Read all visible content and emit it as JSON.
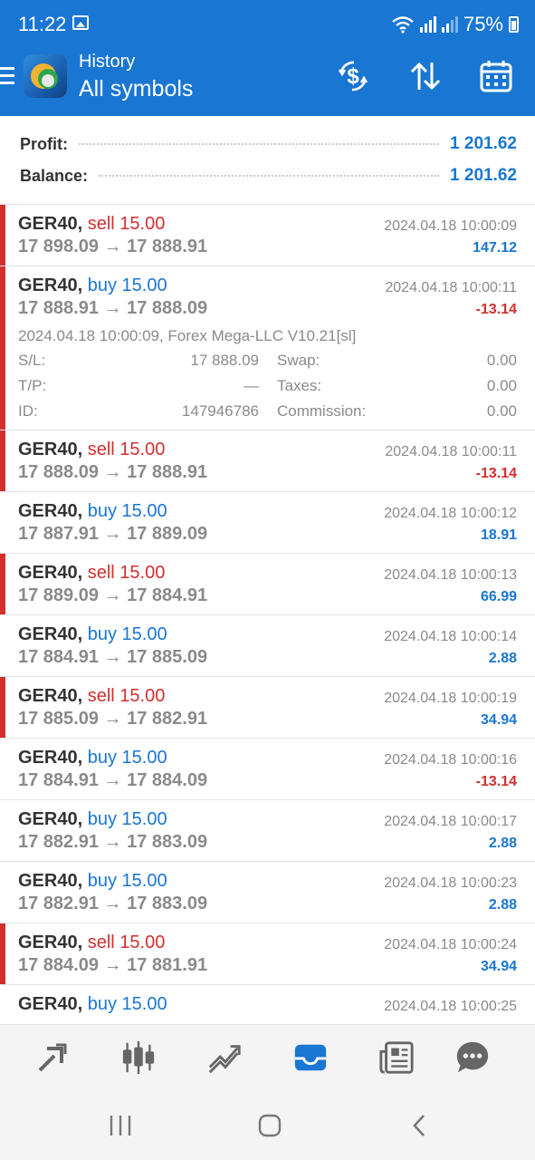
{
  "status_bar": {
    "time": "11:22",
    "battery": "75%"
  },
  "header": {
    "subtitle": "History",
    "title": "All symbols",
    "icons": [
      "menu-icon",
      "app-logo",
      "exchange-dollar-icon",
      "sort-icon",
      "calendar-icon"
    ]
  },
  "summary": {
    "profit_label": "Profit:",
    "profit_value": "1 201.62",
    "balance_label": "Balance:",
    "balance_value": "1 201.62"
  },
  "deals": [
    {
      "symbol": "GER40,",
      "side": "sell",
      "volume": "sell 15.00",
      "prices": "17 898.09 → 17 888.91",
      "time": "2024.04.18 10:00:09",
      "profit": "147.12",
      "profit_sign": "pos"
    },
    {
      "symbol": "GER40,",
      "side": "buy",
      "volume": "buy 15.00",
      "prices": "17 888.91 → 17 888.09",
      "time": "2024.04.18 10:00:11",
      "profit": "-13.14",
      "profit_sign": "neg",
      "details": {
        "comment": "2024.04.18 10:00:09, Forex Mega-LLC V10.21[sl]",
        "sl_label": "S/L:",
        "sl_value": "17 888.09",
        "swap_label": "Swap:",
        "swap_value": "0.00",
        "tp_label": "T/P:",
        "tp_value": "—",
        "taxes_label": "Taxes:",
        "taxes_value": "0.00",
        "id_label": "ID:",
        "id_value": "147946786",
        "commission_label": "Commission:",
        "commission_value": "0.00"
      }
    },
    {
      "symbol": "GER40,",
      "side": "sell",
      "volume": "sell 15.00",
      "prices": "17 888.09 → 17 888.91",
      "time": "2024.04.18 10:00:11",
      "profit": "-13.14",
      "profit_sign": "neg"
    },
    {
      "symbol": "GER40,",
      "side": "buy",
      "volume": "buy 15.00",
      "prices": "17 887.91 → 17 889.09",
      "time": "2024.04.18 10:00:12",
      "profit": "18.91",
      "profit_sign": "pos"
    },
    {
      "symbol": "GER40,",
      "side": "sell",
      "volume": "sell 15.00",
      "prices": "17 889.09 → 17 884.91",
      "time": "2024.04.18 10:00:13",
      "profit": "66.99",
      "profit_sign": "pos"
    },
    {
      "symbol": "GER40,",
      "side": "buy",
      "volume": "buy 15.00",
      "prices": "17 884.91 → 17 885.09",
      "time": "2024.04.18 10:00:14",
      "profit": "2.88",
      "profit_sign": "pos"
    },
    {
      "symbol": "GER40,",
      "side": "sell",
      "volume": "sell 15.00",
      "prices": "17 885.09 → 17 882.91",
      "time": "2024.04.18 10:00:19",
      "profit": "34.94",
      "profit_sign": "pos"
    },
    {
      "symbol": "GER40,",
      "side": "buy",
      "volume": "buy 15.00",
      "prices": "17 884.91 → 17 884.09",
      "time": "2024.04.18 10:00:16",
      "profit": "-13.14",
      "profit_sign": "neg"
    },
    {
      "symbol": "GER40,",
      "side": "buy",
      "volume": "buy 15.00",
      "prices": "17 882.91 → 17 883.09",
      "time": "2024.04.18 10:00:17",
      "profit": "2.88",
      "profit_sign": "pos"
    },
    {
      "symbol": "GER40,",
      "side": "buy",
      "volume": "buy 15.00",
      "prices": "17 882.91 → 17 883.09",
      "time": "2024.04.18 10:00:23",
      "profit": "2.88",
      "profit_sign": "pos"
    },
    {
      "symbol": "GER40,",
      "side": "sell",
      "volume": "sell 15.00",
      "prices": "17 884.09 → 17 881.91",
      "time": "2024.04.18 10:00:24",
      "profit": "34.94",
      "profit_sign": "pos"
    },
    {
      "symbol": "GER40,",
      "side": "buy",
      "volume": "buy 15.00",
      "prices": "",
      "time": "2024.04.18 10:00:25",
      "profit": "",
      "profit_sign": "pos"
    }
  ],
  "bottom_nav": {
    "icons": [
      "trade-icon",
      "chart-icon",
      "analytics-icon",
      "history-icon",
      "news-icon",
      "chat-icon"
    ],
    "active": "history-icon",
    "active_color": "#1976d2"
  },
  "system_nav": {
    "icons": [
      "recent-apps-icon",
      "home-icon",
      "back-icon"
    ]
  },
  "colors": {
    "brand": "#1976d2",
    "sell": "#d32f2f",
    "buy": "#1976d2",
    "text_dark": "#333333",
    "text_muted": "#8a8a8a"
  }
}
